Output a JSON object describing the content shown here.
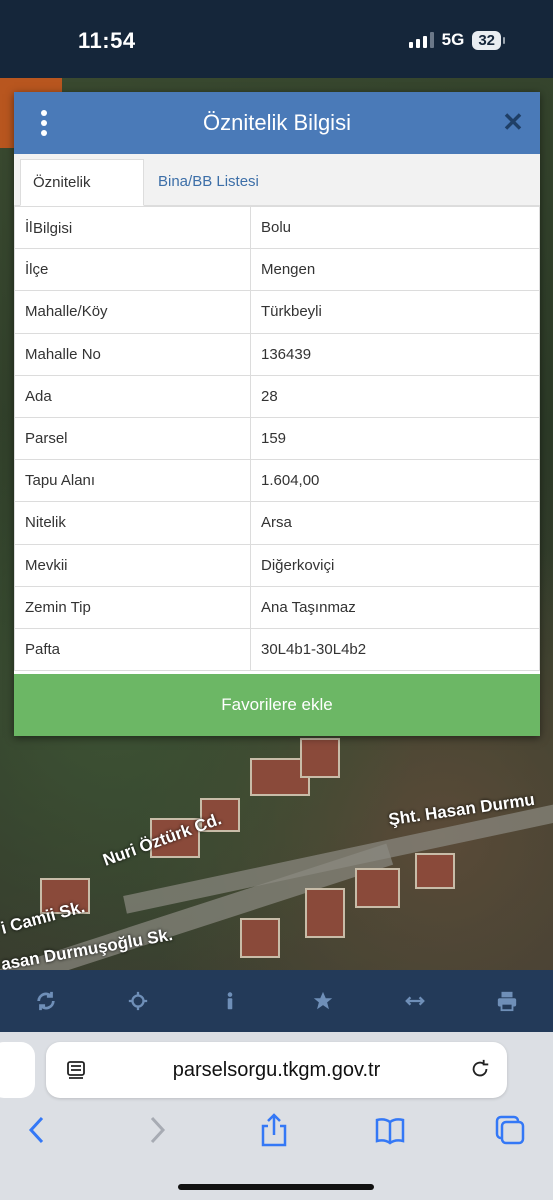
{
  "status_bar": {
    "time": "11:54",
    "network": "5G",
    "battery": "32"
  },
  "modal": {
    "title": "Öznitelik Bilgisi",
    "tabs": [
      {
        "label": "Öznitelik Bilgisi",
        "active": true
      },
      {
        "label": "Bina/BB Listesi",
        "active": false
      }
    ],
    "rows": [
      {
        "label": "İl",
        "value": "Bolu"
      },
      {
        "label": "İlçe",
        "value": "Mengen"
      },
      {
        "label": "Mahalle/Köy",
        "value": "Türkbeyli"
      },
      {
        "label": "Mahalle No",
        "value": "136439"
      },
      {
        "label": "Ada",
        "value": "28"
      },
      {
        "label": "Parsel",
        "value": "159"
      },
      {
        "label": "Tapu Alanı",
        "value": "1.604,00"
      },
      {
        "label": "Nitelik",
        "value": "Arsa"
      },
      {
        "label": "Mevkii",
        "value": "Diğerkoviçi"
      },
      {
        "label": "Zemin Tip",
        "value": "Ana Taşınmaz"
      },
      {
        "label": "Pafta",
        "value": "30L4b1-30L4b2"
      }
    ],
    "favorite_button": "Favorilere ekle"
  },
  "map": {
    "street_labels": [
      "Şht. Hasan Durmu",
      "Nuri Öztürk Cd.",
      "i Camii Sk.",
      "asan Durmuşoğlu Sk."
    ]
  },
  "toolbar": {
    "icons": [
      "refresh-icon",
      "locate-icon",
      "info-icon",
      "star-icon",
      "measure-icon",
      "print-icon"
    ]
  },
  "safari": {
    "url": "parselsorgu.tkgm.gov.tr"
  },
  "colors": {
    "header": "#4a7ab8",
    "favorite": "#6cb765",
    "toolbar": "#233a59"
  }
}
